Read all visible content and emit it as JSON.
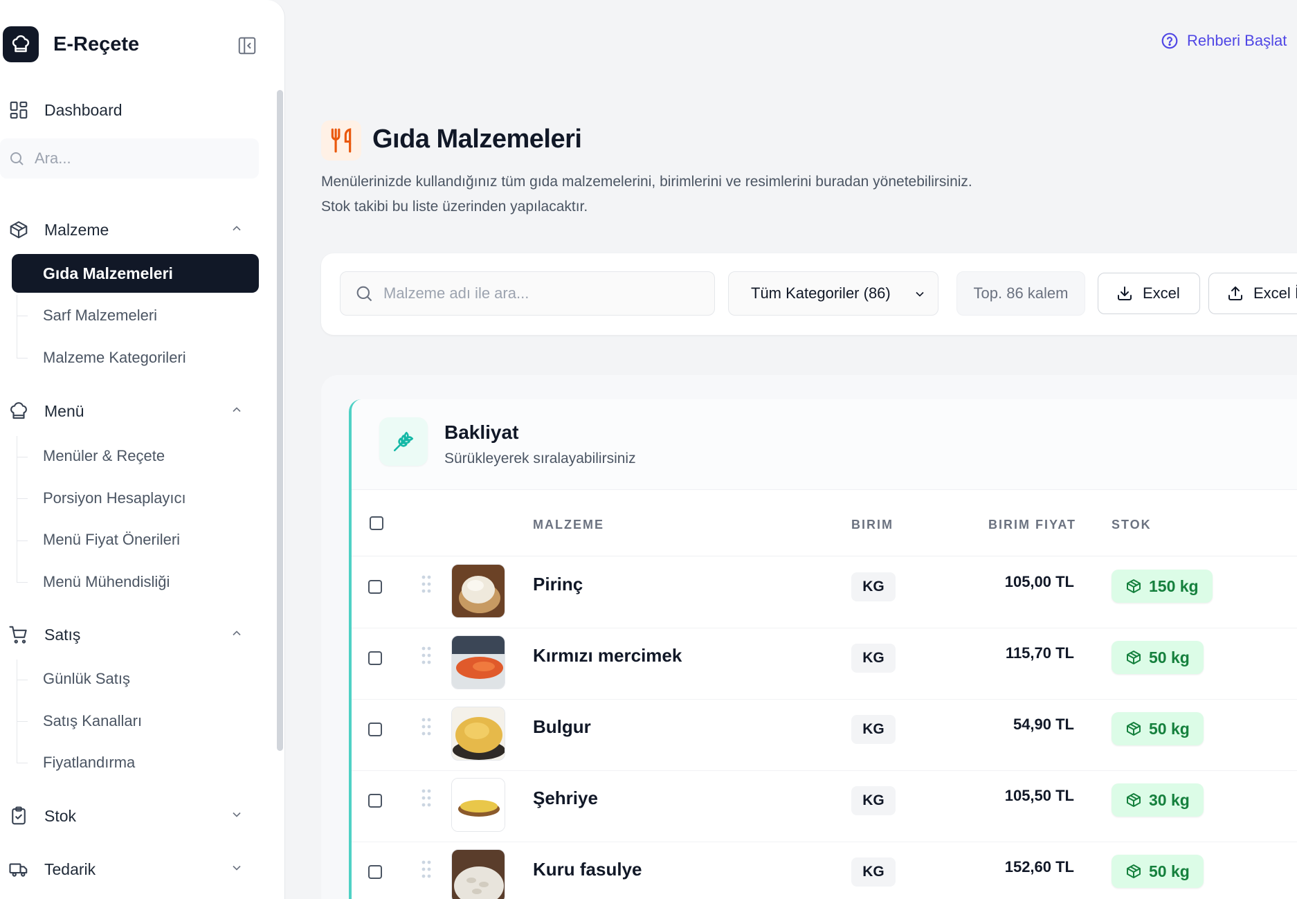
{
  "app": {
    "name": "E-Reçete",
    "guide_label": "Rehberi Başlat"
  },
  "sidebar": {
    "dashboard_label": "Dashboard",
    "search_placeholder": "Ara...",
    "sections": [
      {
        "label": "Malzeme",
        "icon": "box-icon",
        "expanded": true,
        "items": [
          "Gıda Malzemeleri",
          "Sarf Malzemeleri",
          "Malzeme Kategorileri"
        ]
      },
      {
        "label": "Menü",
        "icon": "chef-hat-icon",
        "expanded": true,
        "items": [
          "Menüler & Reçete",
          "Porsiyon Hesaplayıcı",
          "Menü Fiyat Önerileri",
          "Menü Mühendisliği"
        ]
      },
      {
        "label": "Satış",
        "icon": "cart-icon",
        "expanded": true,
        "items": [
          "Günlük Satış",
          "Satış Kanalları",
          "Fiyatlandırma"
        ]
      },
      {
        "label": "Stok",
        "icon": "clipboard-check-icon",
        "expanded": false,
        "items": []
      },
      {
        "label": "Tedarik",
        "icon": "truck-icon",
        "expanded": false,
        "items": []
      }
    ],
    "active_item": "Gıda Malzemeleri"
  },
  "page": {
    "title": "Gıda Malzemeleri",
    "description_line1": "Menülerinizde kullandığınız tüm gıda malzemelerini, birimlerini ve resimlerini buradan yönetebilirsiniz.",
    "description_line2": "Stok takibi bu liste üzerinden yapılacaktır."
  },
  "toolbar": {
    "search_placeholder": "Malzeme adı ile ara...",
    "category_select": "Tüm Kategoriler (86)",
    "total_count": "Top. 86 kalem",
    "export_label": "Excel",
    "import_label": "Excel İ"
  },
  "group": {
    "title": "Bakliyat",
    "subtitle": "Sürükleyerek sıralayabilirsiniz",
    "columns": [
      "MALZEME",
      "BIRIM",
      "BIRIM FIYAT",
      "STOK"
    ],
    "rows": [
      {
        "name": "Pirinç",
        "unit": "KG",
        "price": "105,00 TL",
        "stock": "150 kg"
      },
      {
        "name": "Kırmızı mercimek",
        "unit": "KG",
        "price": "115,70 TL",
        "stock": "50 kg"
      },
      {
        "name": "Bulgur",
        "unit": "KG",
        "price": "54,90 TL",
        "stock": "50 kg"
      },
      {
        "name": "Şehriye",
        "unit": "KG",
        "price": "105,50 TL",
        "stock": "30 kg"
      },
      {
        "name": "Kuru fasulye",
        "unit": "KG",
        "price": "152,60 TL",
        "stock": "50 kg"
      }
    ]
  },
  "colors": {
    "accent": "#4f46e5",
    "dark": "#111827",
    "teal": "#4fd1c5",
    "stock_bg": "#dcfce7",
    "stock_text": "#15803d"
  }
}
